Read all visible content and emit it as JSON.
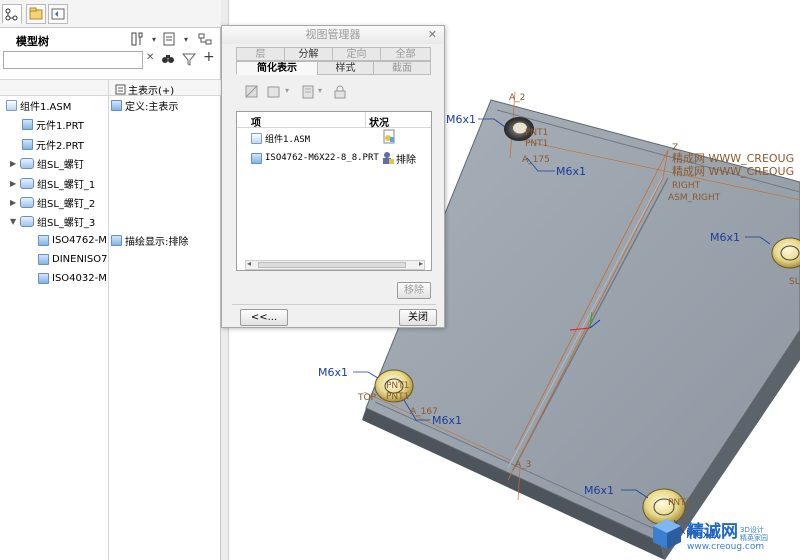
{
  "left_panel": {
    "title": "模型树",
    "column_header": "主表示(+)",
    "tree": [
      {
        "label": "组件1.ASM",
        "icon": "assembly-icon",
        "status": "定义:主表示"
      },
      {
        "label": "元件1.PRT",
        "icon": "part-icon"
      },
      {
        "label": "元件2.PRT",
        "icon": "part-icon"
      },
      {
        "label": "组SL_螺钉",
        "icon": "group-icon"
      },
      {
        "label": "组SL_螺钉_1",
        "icon": "group-icon"
      },
      {
        "label": "组SL_螺钉_2",
        "icon": "group-icon"
      },
      {
        "label": "组SL_螺钉_3",
        "icon": "group-icon"
      },
      {
        "label": "ISO4762-M",
        "icon": "part-icon",
        "status": "描绘显示:排除"
      },
      {
        "label": "DINENISO7",
        "icon": "part-icon"
      },
      {
        "label": "ISO4032-M",
        "icon": "part-icon"
      }
    ],
    "search_value": ""
  },
  "dialog": {
    "title": "视图管理器",
    "tabs_row1": [
      "层",
      "分解",
      "定向",
      "全部"
    ],
    "tabs_row2": [
      "简化表示",
      "样式",
      "截面"
    ],
    "active_tab": "简化表示",
    "col_item": "项",
    "col_status": "状况",
    "rows": [
      {
        "item": "组件1.ASM",
        "status": ""
      },
      {
        "item": "ISO4762-M6X22-8_8.PRT",
        "status": "排除"
      }
    ],
    "remove_label": "移除",
    "back_label": "<<...",
    "close_label": "关闭"
  },
  "viewport": {
    "labels": {
      "m6": "M6x1",
      "a2": "A_2",
      "a175": "A_175",
      "a167": "A_167",
      "pnt": "PNT1",
      "top": "TOP",
      "right": "RIGHT",
      "asm_right": "ASM_RIGHT",
      "z": "Z",
      "wm1": "精成网 WWW_CREOUG",
      "wm2": "精成网 WWW_CREOUG",
      "a3": "A_3",
      "sl": "SL"
    }
  },
  "watermark": {
    "brand": "精诚网",
    "sub": "3D设计 精英家园",
    "url": "www.creoug.com"
  },
  "colors": {
    "plate_top": "#9aa3ad",
    "plate_side": "#5d636a",
    "accent": "#1a3d9c"
  }
}
